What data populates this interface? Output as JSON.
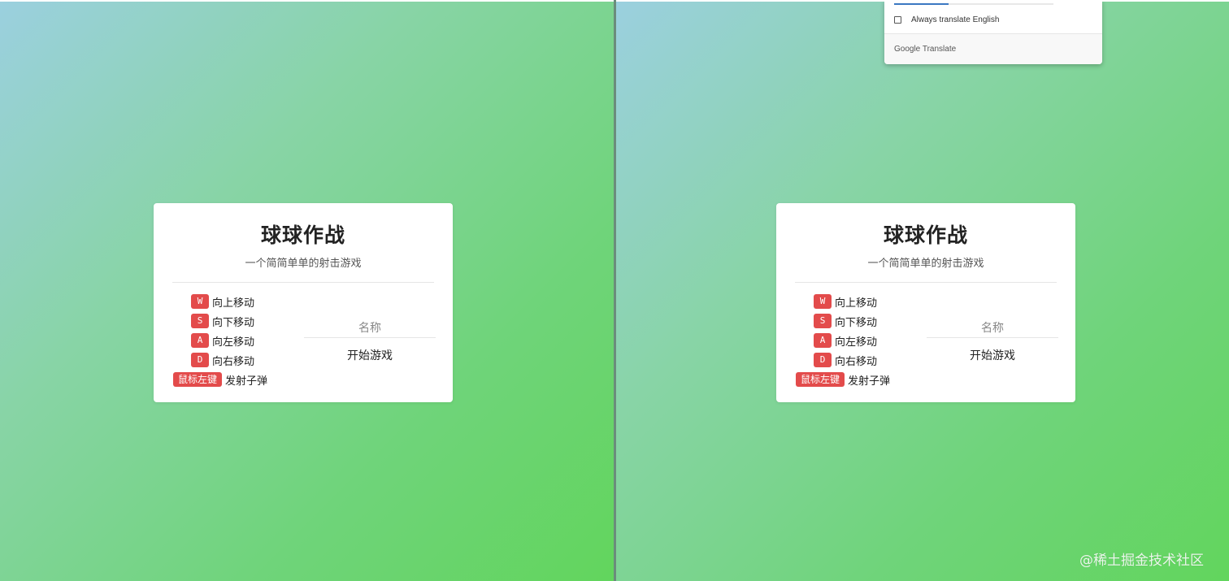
{
  "game": {
    "title": "球球作战",
    "subtitle": "一个简简单单的射击游戏",
    "controls": [
      {
        "key": "W",
        "action": "向上移动"
      },
      {
        "key": "S",
        "action": "向下移动"
      },
      {
        "key": "A",
        "action": "向左移动"
      },
      {
        "key": "D",
        "action": "向右移动"
      },
      {
        "key": "鼠标左键",
        "action": "发射子弹"
      }
    ],
    "name_input": {
      "placeholder": "名称",
      "value": ""
    },
    "start_label": "开始游戏"
  },
  "translate_popup": {
    "progress": 0.34,
    "always_translate_label": "Always translate English",
    "always_translate_checked": false,
    "brand_google": "Google",
    "brand_translate": "Translate"
  },
  "watermark": "@稀土掘金技术社区",
  "colors": {
    "key_badge": "#e34b4b",
    "background_start": "#9bd0df",
    "background_end": "#62d55d",
    "progress_fill": "#3b78c2"
  }
}
